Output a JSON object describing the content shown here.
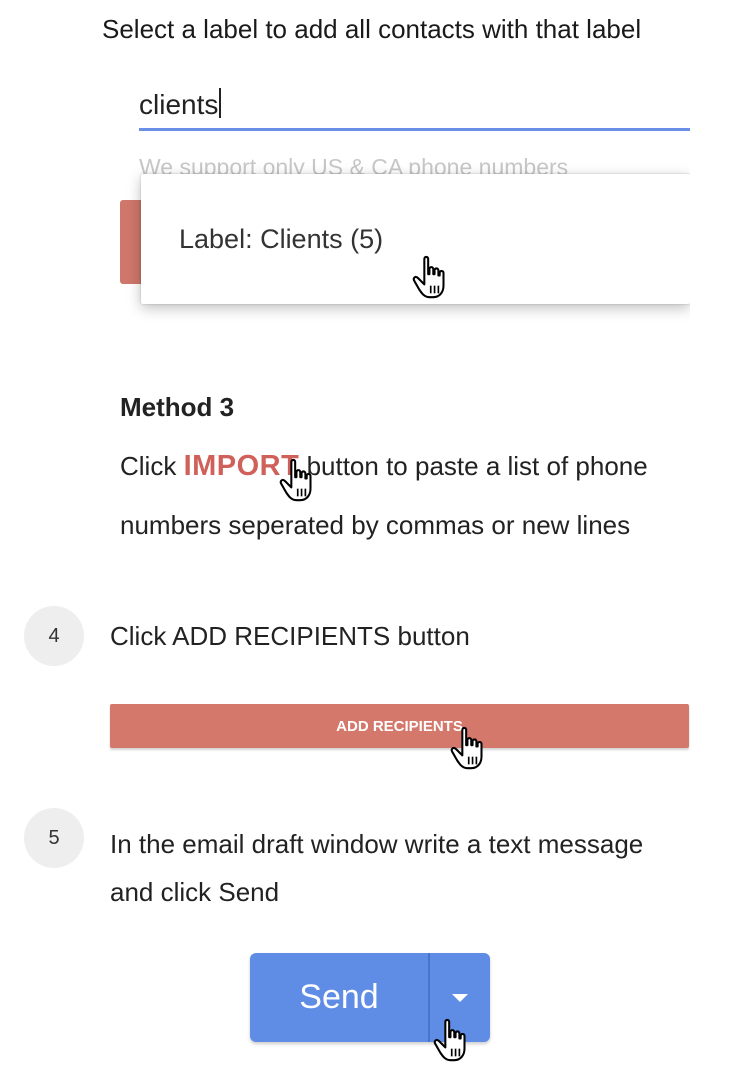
{
  "intro_text": "Select a label to add all contacts with that label",
  "search": {
    "value": "clients",
    "hint": "We support only US & CA phone numbers"
  },
  "dropdown": {
    "item_label": "Label: Clients (5)"
  },
  "method3": {
    "title": "Method 3",
    "click_prefix": "Click ",
    "import_word": "IMPORT",
    "line1_suffix": " button to paste a list of phone",
    "line2": "numbers seperated by commas or new lines"
  },
  "step4": {
    "number": "4",
    "text": "Click ADD RECIPIENTS button",
    "button_label": "ADD RECIPIENTS"
  },
  "step5": {
    "number": "5",
    "text_line1": "In the email draft window write a text message",
    "text_line2": "and click Send",
    "send_label": "Send"
  },
  "icons": {
    "cursor": "hand-pointer-icon",
    "dropdown_arrow": "caret-down-icon"
  },
  "colors": {
    "accent_red": "#d4786c",
    "import_red": "#d0605a",
    "send_blue": "#5f8de6",
    "input_underline": "#6b8ee8"
  }
}
